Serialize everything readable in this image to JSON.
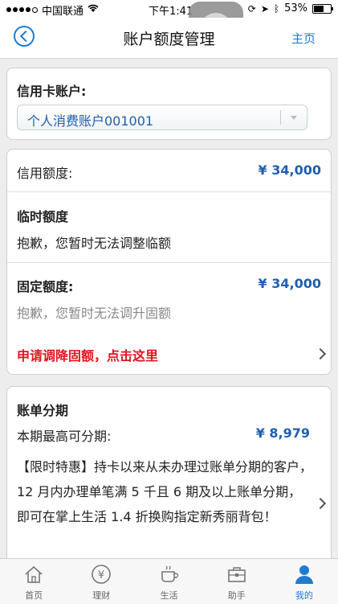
{
  "status": {
    "carrier": "中国联通",
    "time": "下午1:41",
    "battery": "53%",
    "battery_level": 0.53
  },
  "nav": {
    "title": "账户额度管理",
    "home": "主页"
  },
  "account": {
    "label": "信用卡账户:",
    "selected": "个人消费账户001001"
  },
  "limits": {
    "credit_label": "信用额度:",
    "credit_value": "¥ 34,000",
    "temp_label": "临时额度",
    "temp_msg": "抱歉，您暂时无法调整临额",
    "fixed_label": "固定额度:",
    "fixed_value": "¥ 34,000",
    "fixed_msg": "抱歉，您暂时无法调升固额",
    "decrease_link": "申请调降固额，点击这里"
  },
  "installment": {
    "title": "账单分期",
    "max_label": "本期最高可分期:",
    "max_value": "¥ 8,979",
    "promo": "【限时特惠】持卡以来从未办理过账单分期的客户， 12 月内办理单笔满 5 千且 6 期及以上账单分期，即可在掌上生活 1.4 折换购指定新秀丽背包！"
  },
  "tabs": [
    {
      "label": "首页",
      "icon": "home-icon"
    },
    {
      "label": "理财",
      "icon": "wealth-icon"
    },
    {
      "label": "生活",
      "icon": "coffee-cup-icon"
    },
    {
      "label": "助手",
      "icon": "toolbox-icon"
    },
    {
      "label": "我的",
      "icon": "user-icon",
      "active": true
    }
  ],
  "colors": {
    "accent": "#1f7bd0",
    "amount": "#1f5fae",
    "warning": "#e0141e"
  }
}
